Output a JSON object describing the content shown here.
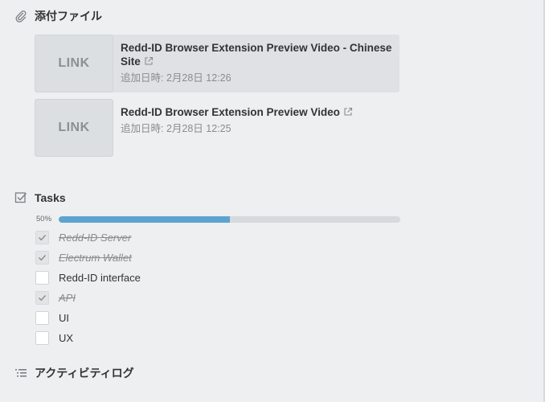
{
  "attachments": {
    "title": "添付ファイル",
    "items": [
      {
        "thumb": "LINK",
        "title": "Redd-ID Browser Extension Preview Video - Chinese Site",
        "date": "追加日時: 2月28日 12:26"
      },
      {
        "thumb": "LINK",
        "title": "Redd-ID Browser Extension Preview Video",
        "date": "追加日時: 2月28日 12:25"
      }
    ]
  },
  "tasks": {
    "title": "Tasks",
    "progress_label": "50%",
    "progress_fraction": 0.5,
    "items": [
      {
        "label": "Redd-ID Server",
        "done": true
      },
      {
        "label": "Electrum Wallet",
        "done": true
      },
      {
        "label": "Redd-ID interface",
        "done": false
      },
      {
        "label": "API",
        "done": true
      },
      {
        "label": "UI",
        "done": false
      },
      {
        "label": "UX",
        "done": false
      }
    ]
  },
  "activity": {
    "title": "アクティビティログ"
  },
  "colors": {
    "progress": "#5ba4cf",
    "background": "#edeff0"
  },
  "icons": {
    "attachments": "paperclip-icon",
    "tasks": "checkbox-icon",
    "activity": "list-icon",
    "external": "external-link-icon"
  }
}
